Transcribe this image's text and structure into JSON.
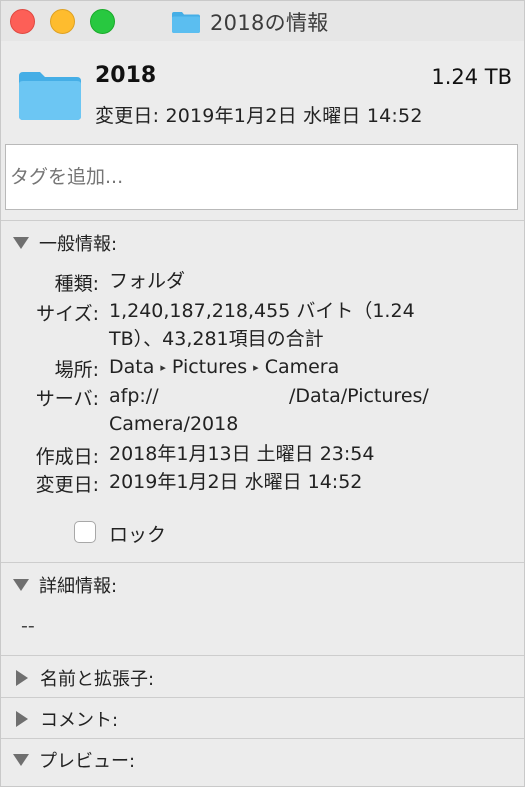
{
  "window": {
    "title": "2018の情報",
    "colors": {
      "folder_blue": "#5bbef0",
      "folder_blue_dark": "#45aee6"
    }
  },
  "header": {
    "name": "2018",
    "size": "1.24 TB",
    "modified": "変更日: 2019年1月2日 水曜日 14:52"
  },
  "tags": {
    "placeholder": "タグを追加..."
  },
  "general": {
    "heading": "一般情報:",
    "rows": [
      {
        "label": "種類:",
        "lines": [
          "フォルダ"
        ]
      },
      {
        "label": "サイズ:",
        "lines": [
          "1,240,187,218,455 バイト（1.24",
          "TB）、43,281項目の合計"
        ]
      },
      {
        "label": "場所:",
        "path": [
          "Data",
          "Pictures",
          "Camera"
        ]
      },
      {
        "label": "サーバ:",
        "lines_a": "afp://",
        "lines_b": "/Data/Pictures/",
        "line2": "Camera/2018"
      },
      {
        "label": "作成日:",
        "lines": [
          "2018年1月13日 土曜日 23:54"
        ]
      },
      {
        "label": "変更日:",
        "lines": [
          "2019年1月2日 水曜日 14:52"
        ]
      }
    ],
    "lock_label": "ロック"
  },
  "details": {
    "heading": "詳細情報:",
    "value": "--"
  },
  "name_ext": {
    "heading": "名前と拡張子:"
  },
  "comments": {
    "heading": "コメント:"
  },
  "preview": {
    "heading": "プレビュー:"
  }
}
